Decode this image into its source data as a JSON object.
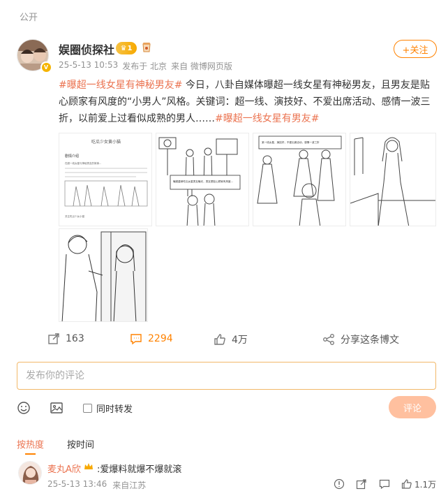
{
  "header": {
    "visibility": "公开"
  },
  "author": {
    "name": "娱圈侦探社",
    "level_badge": "1",
    "avatar_icon": "photo-avatar",
    "verified_icon": "verified-icon"
  },
  "post": {
    "time": "25-5-13 10:53",
    "published_from": "发布于 北京",
    "source": "来自 微博网页版",
    "topic_1": "#曝超一线女星有神秘男友#",
    "body": " 今日，八卦自媒体曝超一线女星有神秘男友，且男友是贴心顾家有风度的“小男人”风格。关键词：超一线、演技好、不爱出席活动、感情一波三折，以前爱上过看似成熟的男人……",
    "topic_2": "#曝超一线女星有男友#"
  },
  "follow_button": {
    "label": "+关注"
  },
  "images": {
    "image_1": {
      "title": "吃瓜少女黄小猫",
      "subtitle": "剧情介绍",
      "text_1": "在超一线女星与神秘男友的故事...",
      "text_2": "关注吃瓜少女小猫"
    },
    "image_2": {
      "caption": "曝超重磅吃瓜女星男友曝光，男友是贴心顾家有风度..."
    },
    "image_3": {
      "caption": "某一线女星，演技好，不爱出席活动，感情一波三折"
    }
  },
  "actions": {
    "repost_count": "163",
    "comment_count": "2294",
    "like_count": "4万",
    "share_label": "分享这条博文"
  },
  "comment_input": {
    "placeholder": "发布你的评论"
  },
  "composer": {
    "repost_label": "同时转发",
    "submit_label": "评论"
  },
  "sort_tabs": {
    "hot": "按热度",
    "time": "按时间"
  },
  "comments": [
    {
      "user": "麦丸A欣",
      "text": ":爱爆料就爆不爆就滚",
      "time": "25-5-13 13:46",
      "source": "来自江苏",
      "likes": "1.1万"
    }
  ],
  "colors": {
    "accent": "#ff8200",
    "topic": "#eb7350",
    "muted": "#939393"
  }
}
